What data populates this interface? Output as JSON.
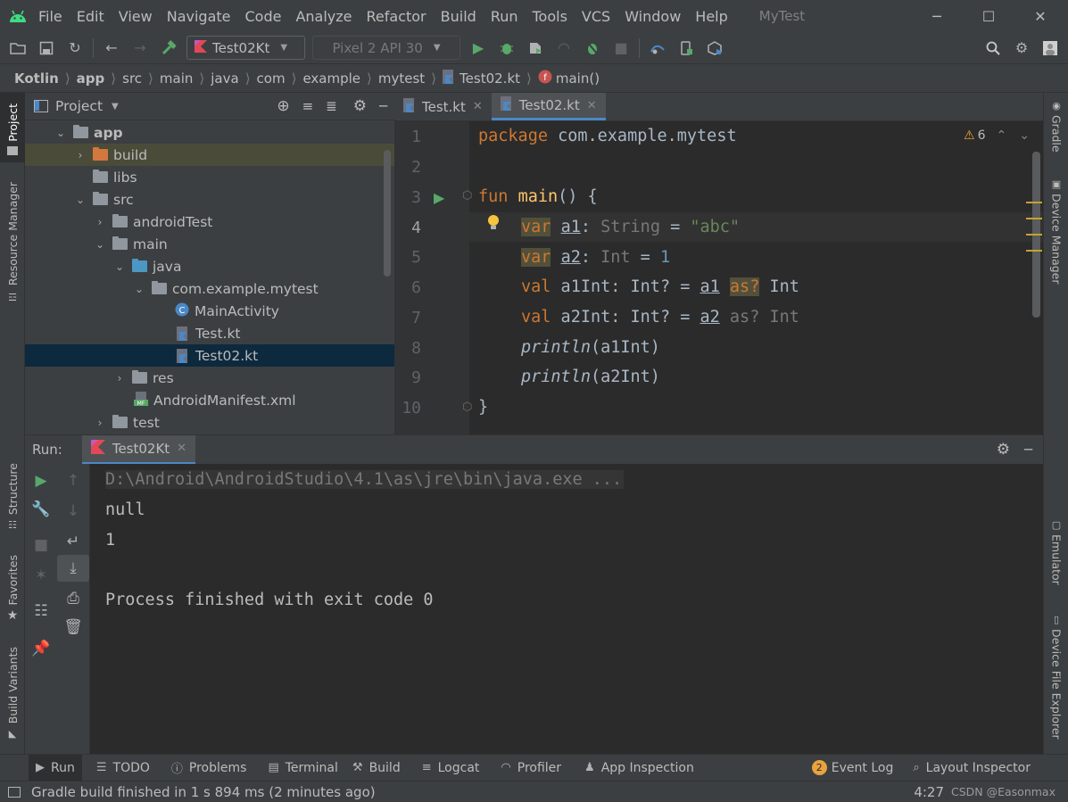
{
  "menu": {
    "items": [
      "File",
      "Edit",
      "View",
      "Navigate",
      "Code",
      "Analyze",
      "Refactor",
      "Build",
      "Run",
      "Tools",
      "VCS",
      "Window",
      "Help"
    ],
    "app_title": "MyTest"
  },
  "toolbar": {
    "run_config": "Test02Kt",
    "device": "Pixel 2 API 30"
  },
  "breadcrumb": [
    "Kotlin",
    "app",
    "src",
    "main",
    "java",
    "com",
    "example",
    "mytest",
    "Test02.kt",
    "main()"
  ],
  "left_strip": {
    "project": "Project",
    "resource_manager": "Resource Manager",
    "structure": "Structure",
    "favorites": "Favorites",
    "build_variants": "Build Variants"
  },
  "right_strip": {
    "gradle": "Gradle",
    "device_manager": "Device Manager",
    "emulator": "Emulator",
    "device_file_explorer": "Device File Explorer"
  },
  "project_panel": {
    "title": "Project",
    "tree": [
      {
        "label": "app",
        "bold": true
      },
      {
        "label": "build"
      },
      {
        "label": "libs"
      },
      {
        "label": "src"
      },
      {
        "label": "androidTest"
      },
      {
        "label": "main"
      },
      {
        "label": "java"
      },
      {
        "label": "com.example.mytest"
      },
      {
        "label": "MainActivity"
      },
      {
        "label": "Test.kt"
      },
      {
        "label": "Test02.kt"
      },
      {
        "label": "res"
      },
      {
        "label": "AndroidManifest.xml"
      },
      {
        "label": "test"
      }
    ]
  },
  "editor": {
    "tabs": [
      "Test.kt",
      "Test02.kt"
    ],
    "active_tab": "Test02.kt",
    "warning_count": "6",
    "line_numbers": [
      "1",
      "2",
      "3",
      "4",
      "5",
      "6",
      "7",
      "8",
      "9",
      "10"
    ]
  },
  "run_panel": {
    "label": "Run:",
    "tab": "Test02Kt",
    "console": [
      "D:\\Android\\AndroidStudio\\4.1\\as\\jre\\bin\\java.exe ...",
      "null",
      "1",
      "",
      "Process finished with exit code 0"
    ]
  },
  "bottom_tabs": {
    "run": "Run",
    "todo": "TODO",
    "problems": "Problems",
    "terminal": "Terminal",
    "build": "Build",
    "logcat": "Logcat",
    "profiler": "Profiler",
    "app_inspection": "App Inspection",
    "event_log_count": "2",
    "event_log": "Event Log",
    "layout_inspector": "Layout Inspector"
  },
  "status": {
    "message": "Gradle build finished in 1 s 894 ms (2 minutes ago)",
    "position": "4:27",
    "watermark": "CSDN @Easonmax"
  },
  "colors": {
    "keyword": "#cc7832",
    "function": "#ffc66d",
    "string": "#6a8759",
    "number": "#6897bb",
    "selection": "#0d293e",
    "accent": "#4a88c7"
  }
}
